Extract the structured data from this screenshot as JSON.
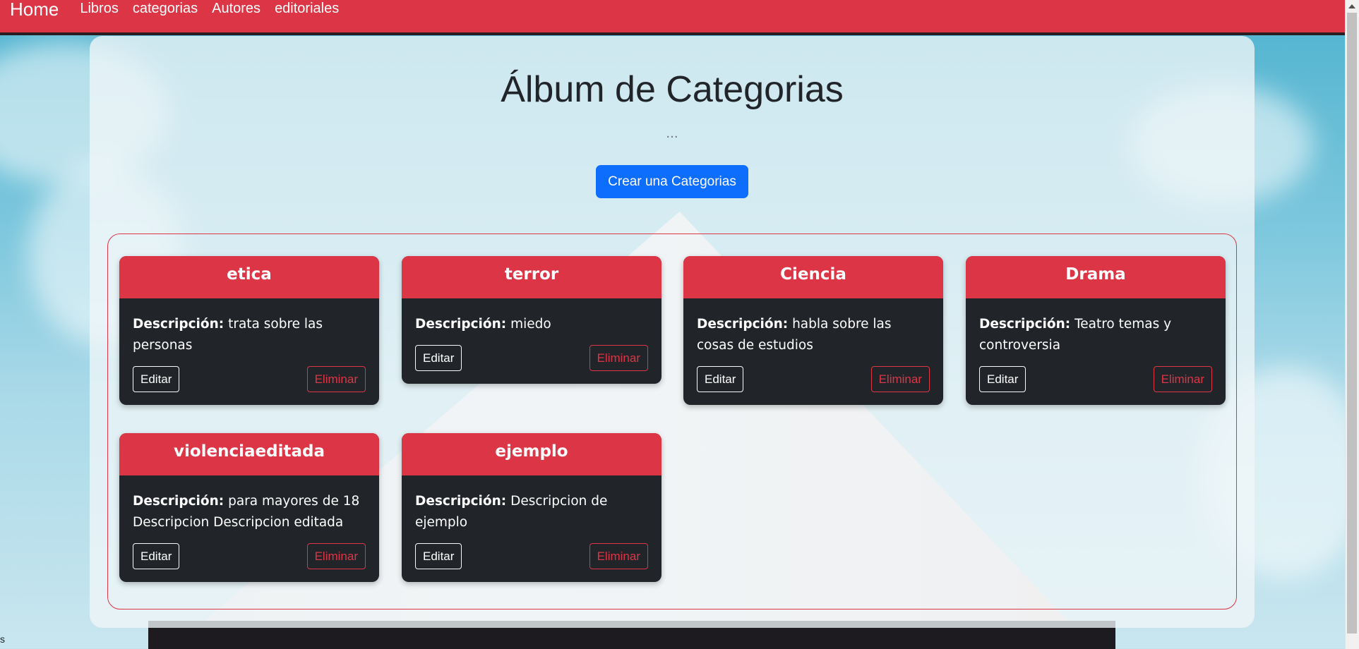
{
  "navbar": {
    "brand": "Home",
    "links": [
      "Libros",
      "categorias",
      "Autores",
      "editoriales"
    ]
  },
  "main": {
    "title": "Álbum de Categorias",
    "subtitle": "...",
    "create_button": "Crear una Categorias"
  },
  "labels": {
    "description": "Descripción:",
    "edit": "Editar",
    "delete": "Eliminar"
  },
  "categories": [
    {
      "name": "etica",
      "description": "trata sobre las personas"
    },
    {
      "name": "terror",
      "description": "miedo"
    },
    {
      "name": "Ciencia",
      "description": "habla sobre las cosas de estudios"
    },
    {
      "name": "Drama",
      "description": "Teatro temas y controversia"
    },
    {
      "name": "violenciaeditada",
      "description": "para mayores de 18 Descripcion Descripcion editada"
    },
    {
      "name": "ejemplo",
      "description": "Descripcion de ejemplo"
    }
  ],
  "status_text": "s",
  "colors": {
    "accent": "#dc3545",
    "primary": "#0d6efd",
    "card": "#212529"
  }
}
